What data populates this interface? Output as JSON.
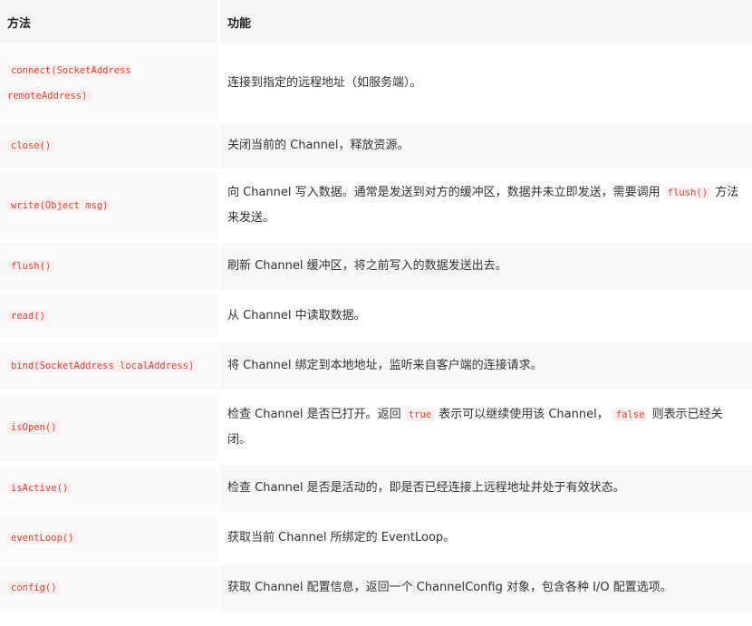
{
  "table": {
    "headers": [
      "方法",
      "功能"
    ],
    "rows": [
      {
        "method": "connect(SocketAddress remoteAddress)",
        "desc": "连接到指定的远程地址（如服务端）。"
      },
      {
        "method": "close()",
        "desc": "关闭当前的 Channel，释放资源。"
      },
      {
        "method": "write(Object msg)",
        "desc_pre": "向 Channel 写入数据。通常是发送到对方的缓冲区，数据并未立即发送，需要调用",
        "desc_code": "flush()",
        "desc_post": "方法来发送。"
      },
      {
        "method": "flush()",
        "desc": "刷新 Channel 缓冲区，将之前写入的数据发送出去。"
      },
      {
        "method": "read()",
        "desc": "从 Channel 中读取数据。"
      },
      {
        "method": "bind(SocketAddress localAddress)",
        "desc": "将 Channel 绑定到本地地址，监听来自客户端的连接请求。"
      },
      {
        "method": "isOpen()",
        "desc_pre": "检查 Channel 是否已打开。返回",
        "desc_code": "true",
        "desc_mid": "表示可以继续使用该 Channel，",
        "desc_code2": "false",
        "desc_post": "则表示已经关闭。"
      },
      {
        "method": "isActive()",
        "desc": "检查 Channel 是否是活动的，即是否已经连接上远程地址并处于有效状态。"
      },
      {
        "method": "eventLoop()",
        "desc": "获取当前 Channel 所绑定的 EventLoop。"
      },
      {
        "method": "config()",
        "desc": "获取 Channel 配置信息，返回一个 ChannelConfig 对象，包含各种 I/O 配置选项。"
      }
    ]
  },
  "colors": {
    "header_bg": "#f2f4f6",
    "code_text": "#e0433b",
    "code_bg": "#fbf0ef",
    "stripe_bg": "#f7f8fa"
  }
}
